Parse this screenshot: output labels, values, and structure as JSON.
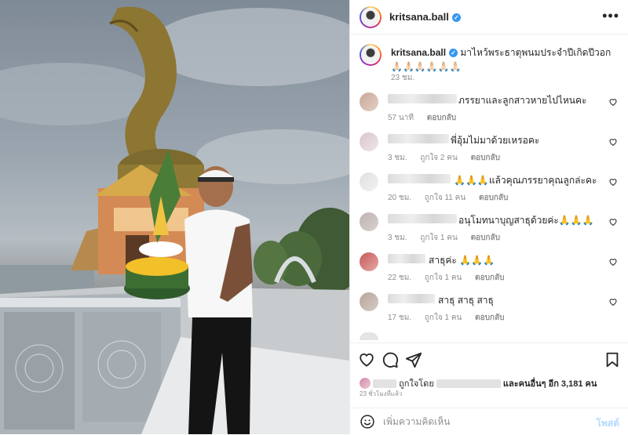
{
  "post": {
    "username": "kritsana.ball",
    "caption": "มาไหว้พระธาตุพนมประจำปีเกิดปีวอก 🙏🏻🙏🏻🙏🏻🙏🏻🙏🏻🙏🏻",
    "caption_time": "23 ชม."
  },
  "comments": [
    {
      "text": "ภรรยาและลูกสาวหายไปไหนคะ",
      "time": "57 นาที",
      "likes": "",
      "reply": "ตอบกลับ"
    },
    {
      "text": "พี่อุ้มไม่มาด้วยเหรอคะ",
      "time": "3 ชม.",
      "likes": "ถูกใจ 2 คน",
      "reply": "ตอบกลับ"
    },
    {
      "text": "🙏🙏🙏แล้วคุณภรรยาคุณลูกล่ะคะ",
      "time": "20 ชม.",
      "likes": "ถูกใจ 11 คน",
      "reply": "ตอบกลับ"
    },
    {
      "text": "อนุโมทนาบุญสาธุด้วยค่ะ🙏🙏🙏",
      "time": "3 ชม.",
      "likes": "ถูกใจ 1 คน",
      "reply": "ตอบกลับ"
    },
    {
      "text": "สาธุค่ะ 🙏🙏🙏",
      "time": "22 ชม.",
      "likes": "ถูกใจ 1 คน",
      "reply": "ตอบกลับ"
    },
    {
      "text": "สาธุ สาธุ สาธุ",
      "time": "17 ชม.",
      "likes": "ถูกใจ 1 คน",
      "reply": "ตอบกลับ"
    }
  ],
  "likes": {
    "prefix": "ถูกใจโดย",
    "suffix": "และคนอื่นๆ อีก 3,181 คน",
    "post_time": "23 ชั่วโมงที่แล้ว"
  },
  "comment_box": {
    "placeholder": "เพิ่มความคิดเห็น",
    "post_label": "โพสต์"
  },
  "colors": {
    "verified": "#3897f0",
    "post_button_disabled": "#b3dbff",
    "secondary_text": "#8e8e8e"
  },
  "icons": [
    "more-icon",
    "verified-icon",
    "heart-icon",
    "comment-icon",
    "share-icon",
    "bookmark-icon",
    "emoji-icon"
  ]
}
